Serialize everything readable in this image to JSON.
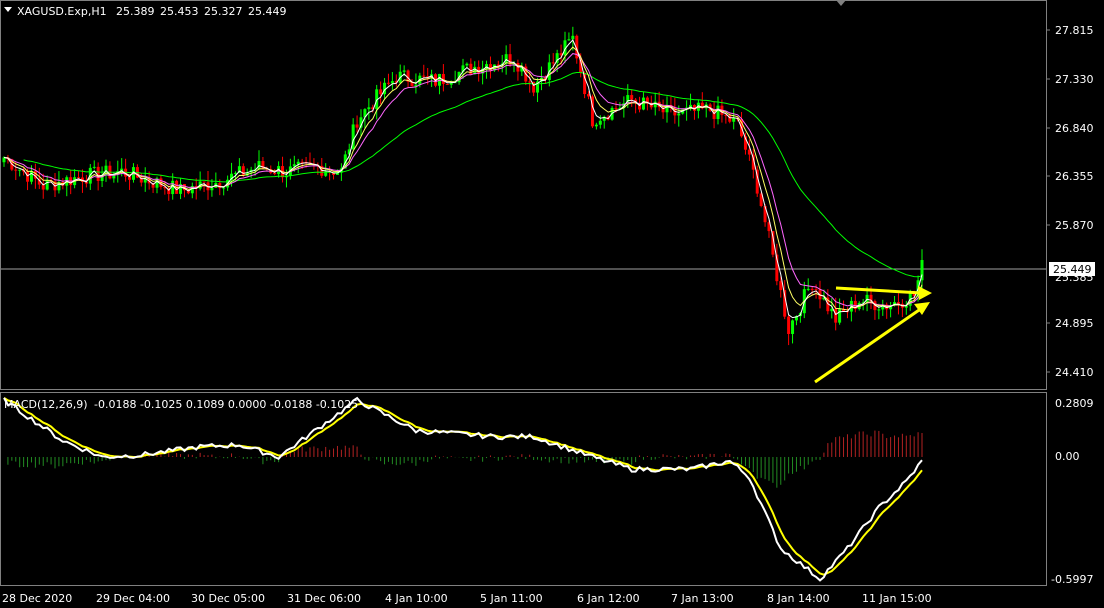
{
  "header": {
    "symbol": "XAGUSD.Exp,H1",
    "open": "25.389",
    "high": "25.453",
    "low": "25.327",
    "close": "25.449"
  },
  "macd_header": {
    "name": "MACD(12,26,9)",
    "values": "-0.0188 -0.1025 0.1089 0.0000 -0.0188 -0.1025"
  },
  "price_axis": [
    "27.815",
    "27.330",
    "26.840",
    "26.355",
    "25.870",
    "25.385",
    "24.895",
    "24.410"
  ],
  "current_price": "25.449",
  "macd_axis": [
    "0.2809",
    "0.00",
    "-0.5997"
  ],
  "time_axis": [
    "28 Dec 2020",
    "29 Dec 04:00",
    "30 Dec 05:00",
    "31 Dec 06:00",
    "4 Jan 10:00",
    "5 Jan 11:00",
    "6 Jan 12:00",
    "7 Jan 13:00",
    "8 Jan 14:00",
    "11 Jan 15:00"
  ],
  "colors": {
    "background": "#000000",
    "bull": "#00ff00",
    "bear": "#ff0000",
    "ma_slow": "#00ff00",
    "ma_mid": "#ff66ff",
    "ma_fast": "#ffff66",
    "ma_white": "#ffffff",
    "macd_line": "#ffffff",
    "signal_line": "#ffff00",
    "arrows": "#ffff00",
    "hist_pos": "#b22222",
    "hist_neg": "#228b22",
    "grid_frame": "#808080"
  },
  "chart_data": {
    "type": "candlestick",
    "price_key_points": [
      [
        0,
        26.6
      ],
      [
        10,
        26.3
      ],
      [
        20,
        26.4
      ],
      [
        30,
        26.45
      ],
      [
        45,
        26.25
      ],
      [
        55,
        26.35
      ],
      [
        65,
        26.5
      ],
      [
        72,
        26.45
      ],
      [
        80,
        26.5
      ],
      [
        86,
        26.45
      ],
      [
        90,
        27.0
      ],
      [
        100,
        27.45
      ],
      [
        110,
        27.4
      ],
      [
        120,
        27.55
      ],
      [
        130,
        27.65
      ],
      [
        135,
        27.35
      ],
      [
        145,
        27.85
      ],
      [
        150,
        27.0
      ],
      [
        160,
        27.2
      ],
      [
        170,
        27.05
      ],
      [
        180,
        27.1
      ],
      [
        187,
        26.95
      ],
      [
        192,
        26.3
      ],
      [
        200,
        24.8
      ],
      [
        206,
        25.3
      ],
      [
        212,
        24.9
      ],
      [
        218,
        25.1
      ],
      [
        225,
        25.05
      ],
      [
        232,
        25.15
      ],
      [
        234,
        25.45
      ]
    ],
    "bars": 235,
    "y_range": [
      24.2,
      28.02
    ],
    "macd_key_points": [
      [
        0,
        0.28
      ],
      [
        15,
        0.08
      ],
      [
        25,
        0.0
      ],
      [
        35,
        0.01
      ],
      [
        50,
        0.05
      ],
      [
        60,
        0.06
      ],
      [
        70,
        0.0
      ],
      [
        90,
        0.28
      ],
      [
        105,
        0.13
      ],
      [
        125,
        0.1
      ],
      [
        135,
        0.1
      ],
      [
        150,
        0.0
      ],
      [
        160,
        -0.06
      ],
      [
        175,
        -0.06
      ],
      [
        185,
        -0.02
      ],
      [
        190,
        -0.1
      ],
      [
        198,
        -0.45
      ],
      [
        208,
        -0.6
      ],
      [
        215,
        -0.45
      ],
      [
        223,
        -0.25
      ],
      [
        230,
        -0.12
      ],
      [
        234,
        -0.02
      ]
    ],
    "macd_y_range": [
      -0.62,
      0.3
    ],
    "histogram": "positive after bar 205, negative 8 Jan dip",
    "triangle_pattern": {
      "upper_line": "descending from 25.24 to 25.14",
      "lower_line": "ascending from 24.4 to 25.05"
    }
  }
}
